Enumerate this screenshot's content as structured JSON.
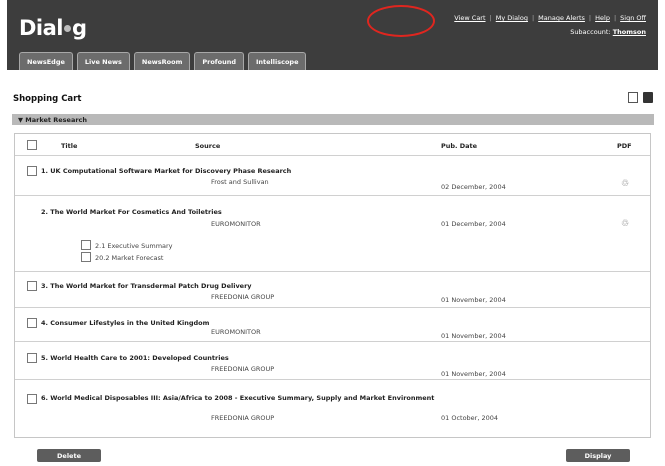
{
  "header": {
    "logo_text_before": "Dial",
    "logo_text_after": "g",
    "links": [
      "View Cart",
      "My Dialog",
      "Manage Alerts",
      "Help",
      "Sign Off"
    ],
    "subaccount_label": "Subaccount:",
    "subaccount_value": "Thomson"
  },
  "tabs": [
    "NewsEdge",
    "Live News",
    "NewsRoom",
    "Profound",
    "Intelliscope"
  ],
  "page_title": "Shopping Cart",
  "section": "▼ Market Research",
  "table": {
    "headers": {
      "title": "Title",
      "source": "Source",
      "date": "Pub. Date",
      "pdf": "PDF"
    },
    "rows": [
      {
        "title": "1. UK Computational Software Market for Discovery Phase Research",
        "source": "Frost and Sullivan",
        "date": "02 December, 2004",
        "pdf": true
      },
      {
        "title": "2. The World Market For Cosmetics And Toiletries",
        "source": "EUROMONITOR",
        "date": "01 December, 2004",
        "pdf": true,
        "subitems": [
          "2.1  Executive Summary",
          "20.2  Market Forecast"
        ]
      },
      {
        "title": "3. The World Market for Transdermal Patch Drug Delivery",
        "source": "FREEDONIA GROUP",
        "date": "01 November, 2004"
      },
      {
        "title": "4. Consumer Lifestyles in the United Kingdom",
        "source": "EUROMONITOR",
        "date": "01 November, 2004"
      },
      {
        "title": "5. World Health Care to 2001: Developed Countries",
        "source": "FREEDONIA GROUP",
        "date": "01 November, 2004"
      },
      {
        "title": "6. World Medical Disposables III: Asia/Africa to 2008 - Executive Summary, Supply and Market Environment",
        "source": "FREEDONIA GROUP",
        "date": "01 October, 2004"
      }
    ]
  },
  "buttons": {
    "delete": "Delete",
    "display": "Display"
  },
  "colors": {
    "header_bg": "#3d3d3d",
    "tab_bg": "#6c6c6c",
    "section_bg": "#b9b9b9",
    "highlight_circle": "#e0261f"
  }
}
